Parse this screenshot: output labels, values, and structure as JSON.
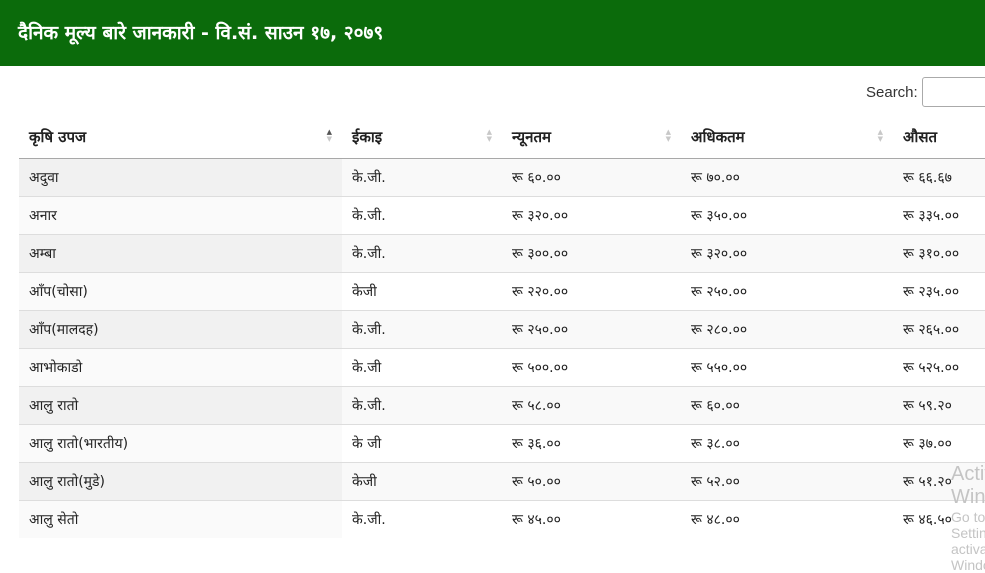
{
  "header": {
    "title": "दैनिक मूल्य बारे जानकारी - वि.सं. साउन १७, २०७९"
  },
  "search": {
    "label": "Search:",
    "value": ""
  },
  "table": {
    "columns": [
      {
        "label": "कृषि उपज",
        "sort": "asc"
      },
      {
        "label": "ईकाइ",
        "sort": "none"
      },
      {
        "label": "न्यूनतम",
        "sort": "none"
      },
      {
        "label": "अधिकतम",
        "sort": "none"
      },
      {
        "label": "औसत",
        "sort": "none"
      }
    ],
    "rows": [
      [
        "अदुवा",
        "के.जी.",
        "रू ६०.००",
        "रू ७०.००",
        "रू ६६.६७"
      ],
      [
        "अनार",
        "के.जी.",
        "रू ३२०.००",
        "रू ३५०.००",
        "रू ३३५.००"
      ],
      [
        "अम्बा",
        "के.जी.",
        "रू ३००.००",
        "रू ३२०.००",
        "रू ३१०.००"
      ],
      [
        "आँप(चोसा)",
        "केजी",
        "रू २२०.००",
        "रू २५०.००",
        "रू २३५.००"
      ],
      [
        "आँप(मालदह)",
        "के.जी.",
        "रू २५०.००",
        "रू २८०.००",
        "रू २६५.००"
      ],
      [
        "आभोकाडो",
        "के.जी",
        "रू ५००.००",
        "रू ५५०.००",
        "रू ५२५.००"
      ],
      [
        "आलु रातो",
        "के.जी.",
        "रू ५८.००",
        "रू ६०.००",
        "रू ५९.२०"
      ],
      [
        "आलु रातो(भारतीय)",
        "के जी",
        "रू ३६.००",
        "रू ३८.००",
        "रू ३७.००"
      ],
      [
        "आलु रातो(मुडे)",
        "केजी",
        "रू ५०.००",
        "रू ५२.००",
        "रू ५१.२०"
      ],
      [
        "आलु सेतो",
        "के.जी.",
        "रू ४५.००",
        "रू ४८.००",
        "रू ४६.५०"
      ]
    ]
  },
  "watermark": {
    "line1": "Activate Windows",
    "line2": "Go to Settings to activate Windows."
  }
}
